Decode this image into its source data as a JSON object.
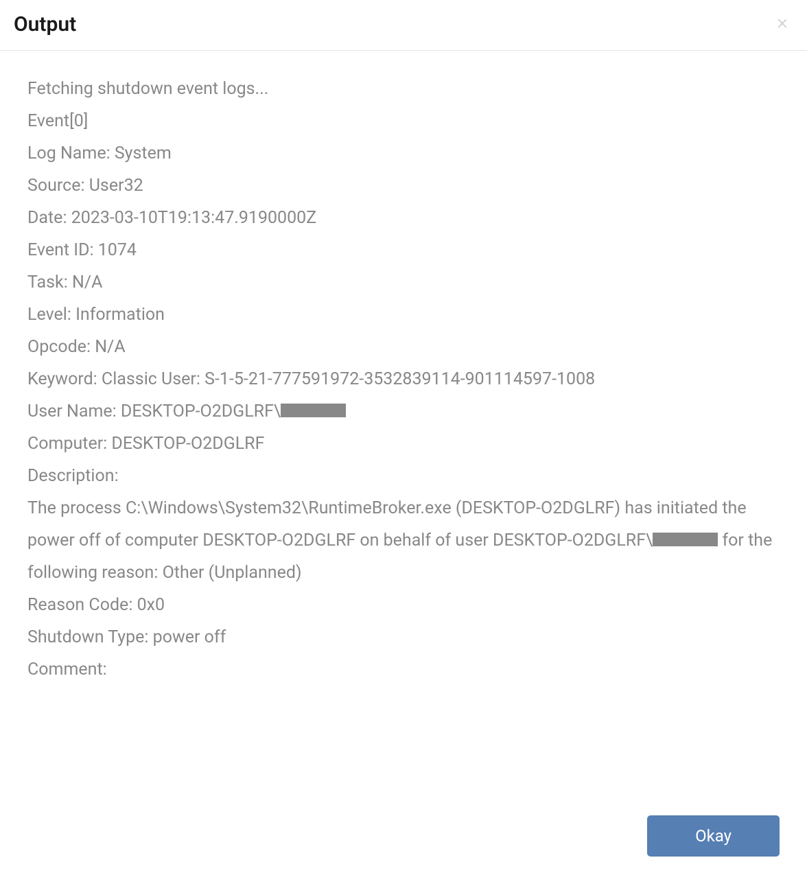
{
  "header": {
    "title": "Output"
  },
  "log": {
    "lines": [
      "Fetching shutdown event logs...",
      "Event[0]",
      "Log Name: System",
      "Source: User32",
      "Date: 2023-03-10T19:13:47.9190000Z",
      "Event ID: 1074",
      "Task: N/A",
      "Level: Information",
      "Opcode: N/A",
      "Keyword: Classic User: S-1-5-21-777591972-3532839114-901114597-1008"
    ],
    "user_name_prefix": "User Name: DESKTOP-O2DGLRF\\",
    "computer": "Computer: DESKTOP-O2DGLRF",
    "description_label": "Description:",
    "description_part1": "The process C:\\Windows\\System32\\RuntimeBroker.exe (DESKTOP-O2DGLRF) has initiated the power off of computer DESKTOP-O2DGLRF on behalf of user DESKTOP-O2DGLRF\\",
    "description_part2": " for the following reason: Other (Unplanned)",
    "reason_code": "Reason Code: 0x0",
    "shutdown_type": "Shutdown Type: power off",
    "comment": "Comment:"
  },
  "footer": {
    "okay_label": "Okay"
  }
}
